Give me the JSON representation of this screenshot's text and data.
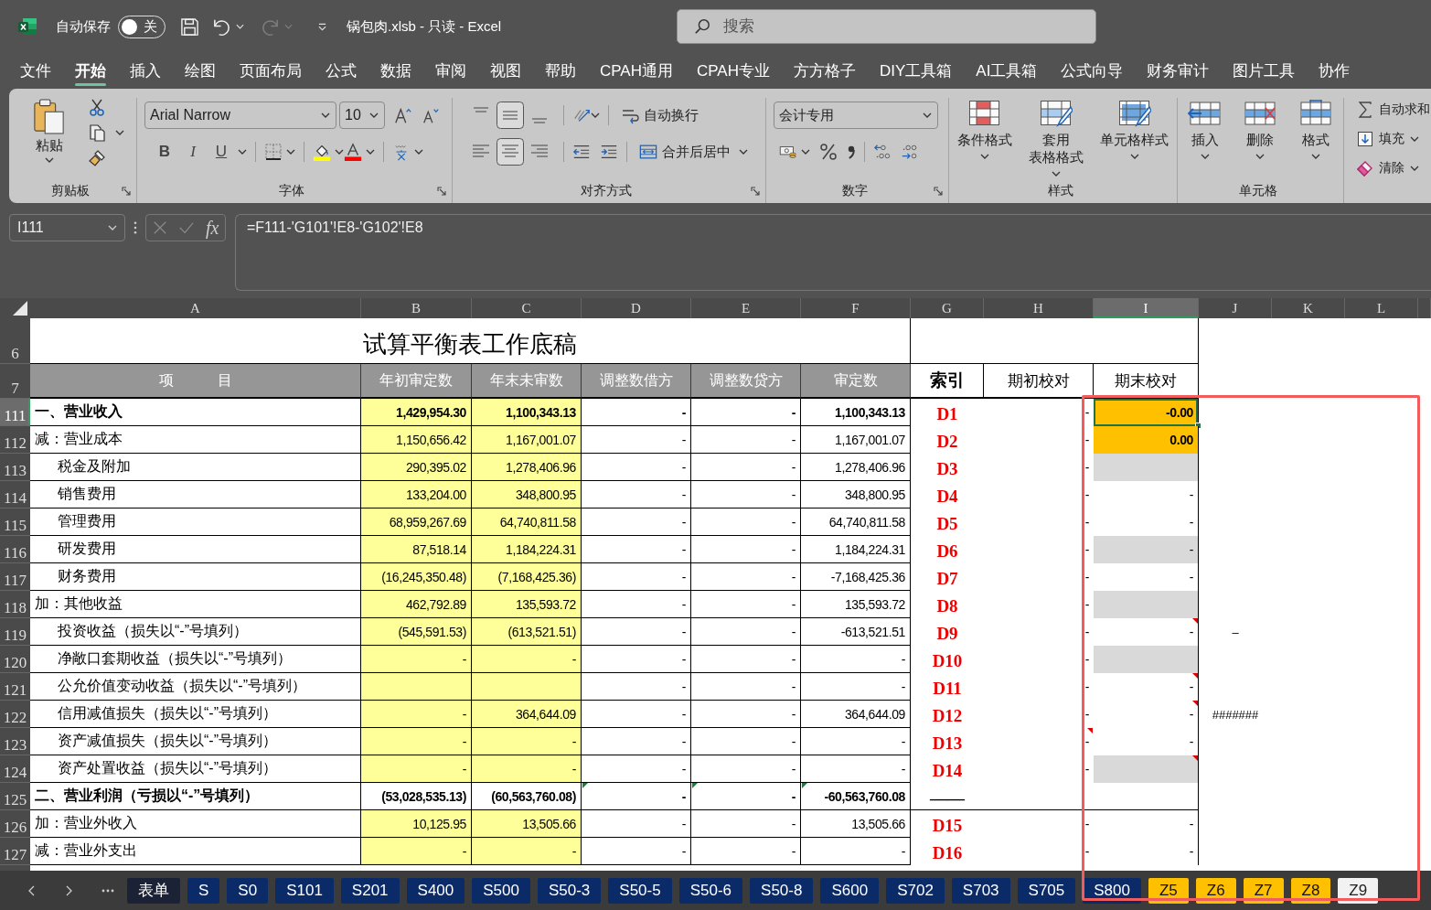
{
  "title_bar": {
    "autosave_label": "自动保存",
    "autosave_on": false,
    "autosave_state": "关",
    "redo_disabled": true,
    "document_title": "锅包肉.xlsb - 只读 - Excel",
    "search": {
      "placeholder": "搜索"
    }
  },
  "menu_tabs": [
    {
      "label": "文件",
      "selected": false
    },
    {
      "label": "开始",
      "selected": true
    },
    {
      "label": "插入",
      "selected": false
    },
    {
      "label": "绘图",
      "selected": false
    },
    {
      "label": "页面布局",
      "selected": false
    },
    {
      "label": "公式",
      "selected": false
    },
    {
      "label": "数据",
      "selected": false
    },
    {
      "label": "审阅",
      "selected": false
    },
    {
      "label": "视图",
      "selected": false
    },
    {
      "label": "帮助",
      "selected": false
    },
    {
      "label": "CPAH通用",
      "selected": false
    },
    {
      "label": "CPAH专业",
      "selected": false
    },
    {
      "label": "方方格子",
      "selected": false
    },
    {
      "label": "DIY工具箱",
      "selected": false
    },
    {
      "label": "AI工具箱",
      "selected": false
    },
    {
      "label": "公式向导",
      "selected": false
    },
    {
      "label": "财务审计",
      "selected": false
    },
    {
      "label": "图片工具",
      "selected": false
    },
    {
      "label": "协作",
      "selected": false
    }
  ],
  "ribbon": {
    "clipboard": {
      "paste_label": "粘贴",
      "group_label": "剪贴板"
    },
    "font": {
      "font_name": "Arial Narrow",
      "font_size": "10",
      "style_buttons": [
        "B",
        "I",
        "U"
      ],
      "group_label": "字体"
    },
    "alignment": {
      "vertical": [
        {
          "selected": false
        },
        {
          "selected": true
        },
        {
          "selected": false
        }
      ],
      "horizontal": [
        {
          "selected": false
        },
        {
          "selected": true
        },
        {
          "selected": false
        }
      ],
      "wrap_label": "自动换行",
      "merge_label": "合并后居中",
      "group_label": "对齐方式"
    },
    "number": {
      "format": "会计专用",
      "group_label": "数字"
    },
    "styles": {
      "buttons": [
        {
          "kind": "conditional",
          "lines": [
            "条件格式"
          ]
        },
        {
          "kind": "table",
          "lines": [
            "套用",
            "表格格式"
          ]
        },
        {
          "kind": "cell_style",
          "lines": [
            "单元格样式"
          ]
        }
      ],
      "group_label": "样式"
    },
    "cells": {
      "buttons": [
        {
          "kind": "insert",
          "label": "插入"
        },
        {
          "kind": "delete",
          "label": "删除"
        },
        {
          "kind": "format",
          "label": "格式"
        }
      ],
      "group_label": "单元格"
    },
    "editing": {
      "items": [
        {
          "kind": "sum",
          "label": "自动求和"
        },
        {
          "kind": "fill",
          "label": "填充"
        },
        {
          "kind": "clear",
          "label": "清除"
        }
      ]
    }
  },
  "formula_bar": {
    "name_box": "I111",
    "function_label": "fx",
    "formula": "=F111-'G101'!E8-'G102'!E8"
  },
  "sheet": {
    "columns": [
      {
        "letter": "A",
        "selected": false
      },
      {
        "letter": "B",
        "selected": false
      },
      {
        "letter": "C",
        "selected": false
      },
      {
        "letter": "D",
        "selected": false
      },
      {
        "letter": "E",
        "selected": false
      },
      {
        "letter": "F",
        "selected": false
      },
      {
        "letter": "G",
        "selected": false
      },
      {
        "letter": "H",
        "selected": false
      },
      {
        "letter": "I",
        "selected": true
      },
      {
        "letter": "J",
        "selected": false
      },
      {
        "letter": "K",
        "selected": false
      },
      {
        "letter": "L",
        "selected": false
      }
    ],
    "title_row": "6",
    "title": "试算平衡表工作底稿",
    "header_row": "7",
    "headers": [
      "项　　　目",
      "年初审定数",
      "年末未审数",
      "调整数借方",
      "调整数贷方",
      "审定数",
      "索引",
      "期初校对",
      "期末校对"
    ],
    "rows": [
      {
        "number": "111",
        "selected": true,
        "kind": "item",
        "bold": true,
        "indented": false,
        "item": "一、营业收入",
        "opening_audited": "1,429,954.30",
        "closing_unaudited": "1,100,343.13",
        "adjust_debit": "-",
        "adjust_credit": "-",
        "audited": "1,100,343.13",
        "index": "D1",
        "opening_check": {
          "text": "-",
          "comment": false
        },
        "closing_check": {
          "text": "-0.00",
          "color": "#ffc000",
          "bold": true,
          "comment": false
        }
      },
      {
        "number": "112",
        "selected": false,
        "kind": "item",
        "bold": false,
        "indented": false,
        "item": "减：营业成本",
        "opening_audited": "1,150,656.42",
        "closing_unaudited": "1,167,001.07",
        "adjust_debit": "-",
        "adjust_credit": "-",
        "audited": "1,167,001.07",
        "index": "D2",
        "opening_check": {
          "text": "-",
          "comment": false
        },
        "closing_check": {
          "text": "0.00",
          "color": "#ffc000",
          "bold": true,
          "comment": false
        }
      },
      {
        "number": "113",
        "selected": false,
        "kind": "item",
        "bold": false,
        "indented": true,
        "item": "税金及附加",
        "opening_audited": "290,395.02",
        "closing_unaudited": "1,278,406.96",
        "adjust_debit": "-",
        "adjust_credit": "-",
        "audited": "1,278,406.96",
        "index": "D3",
        "opening_check": {
          "text": "-",
          "comment": false
        },
        "closing_check": {
          "color": "#d9d9d9",
          "comment": false
        }
      },
      {
        "number": "114",
        "selected": false,
        "kind": "item",
        "bold": false,
        "indented": true,
        "item": "销售费用",
        "opening_audited": "133,204.00",
        "closing_unaudited": "348,800.95",
        "adjust_debit": "-",
        "adjust_credit": "-",
        "audited": "348,800.95",
        "index": "D4",
        "opening_check": {
          "text": "-",
          "comment": false
        },
        "closing_check": {
          "text": "-",
          "bold": false,
          "comment": false
        }
      },
      {
        "number": "115",
        "selected": false,
        "kind": "item",
        "bold": false,
        "indented": true,
        "item": "管理费用",
        "opening_audited": "68,959,267.69",
        "closing_unaudited": "64,740,811.58",
        "adjust_debit": "-",
        "adjust_credit": "-",
        "audited": "64,740,811.58",
        "index": "D5",
        "opening_check": {
          "text": "-",
          "comment": false
        },
        "closing_check": {
          "text": "-",
          "bold": false,
          "comment": false
        }
      },
      {
        "number": "116",
        "selected": false,
        "kind": "item",
        "bold": false,
        "indented": true,
        "item": "研发费用",
        "opening_audited": "87,518.14",
        "closing_unaudited": "1,184,224.31",
        "adjust_debit": "-",
        "adjust_credit": "-",
        "audited": "1,184,224.31",
        "index": "D6",
        "opening_check": {
          "text": "-",
          "comment": false
        },
        "closing_check": {
          "text": "-",
          "color": "#d9d9d9",
          "bold": false,
          "comment": false
        }
      },
      {
        "number": "117",
        "selected": false,
        "kind": "item",
        "bold": false,
        "indented": true,
        "item": "财务费用",
        "opening_audited": "(16,245,350.48)",
        "closing_unaudited": "(7,168,425.36)",
        "adjust_debit": "-",
        "adjust_credit": "-",
        "audited": "-7,168,425.36",
        "index": "D7",
        "opening_check": {
          "text": "-",
          "comment": false
        },
        "closing_check": {
          "text": "-",
          "bold": false,
          "comment": false
        }
      },
      {
        "number": "118",
        "selected": false,
        "kind": "item",
        "bold": false,
        "indented": false,
        "item": "加：其他收益",
        "opening_audited": "462,792.89",
        "closing_unaudited": "135,593.72",
        "adjust_debit": "-",
        "adjust_credit": "-",
        "audited": "135,593.72",
        "index": "D8",
        "opening_check": {
          "text": "-",
          "comment": false
        },
        "closing_check": {
          "color": "#d9d9d9",
          "comment": false
        }
      },
      {
        "number": "119",
        "selected": false,
        "kind": "item",
        "bold": false,
        "indented": true,
        "item": "投资收益（损失以“-”号填列）",
        "opening_audited": "(545,591.53)",
        "closing_unaudited": "(613,521.51)",
        "adjust_debit": "-",
        "adjust_credit": "-",
        "audited": "-613,521.51",
        "index": "D9",
        "opening_check": {
          "text": "-",
          "comment": false
        },
        "closing_check": {
          "text": "-",
          "bold": false,
          "comment": true
        },
        "column_j": "–"
      },
      {
        "number": "120",
        "selected": false,
        "kind": "item",
        "bold": false,
        "indented": true,
        "item": "净敞口套期收益（损失以“-”号填列）",
        "opening_audited": "-",
        "closing_unaudited": "-",
        "adjust_debit": "-",
        "adjust_credit": "-",
        "audited": "-",
        "index": "D10",
        "opening_check": {
          "text": "-",
          "comment": false
        },
        "closing_check": {
          "color": "#d9d9d9",
          "comment": false
        }
      },
      {
        "number": "121",
        "selected": false,
        "kind": "item",
        "bold": false,
        "indented": true,
        "item": "公允价值变动收益（损失以“-”号填列）",
        "adjust_debit": "-",
        "adjust_credit": "-",
        "audited": "-",
        "index": "D11",
        "opening_check": {
          "text": "-",
          "comment": false
        },
        "closing_check": {
          "text": "-",
          "bold": false,
          "comment": true
        }
      },
      {
        "number": "122",
        "selected": false,
        "kind": "item",
        "bold": false,
        "indented": true,
        "item": "信用减值损失（损失以“-”号填列）",
        "opening_audited": "-",
        "closing_unaudited": "364,644.09",
        "adjust_debit": "-",
        "adjust_credit": "-",
        "audited": "364,644.09",
        "index": "D12",
        "opening_check": {
          "text": "-",
          "comment": false
        },
        "closing_check": {
          "text": "-",
          "bold": false,
          "comment": true
        },
        "column_j": "#######"
      },
      {
        "number": "123",
        "selected": false,
        "kind": "item",
        "bold": false,
        "indented": true,
        "item": "资产减值损失（损失以“-”号填列）",
        "opening_audited": "-",
        "closing_unaudited": "-",
        "adjust_debit": "-",
        "adjust_credit": "-",
        "audited": "-",
        "index": "D13",
        "opening_check": {
          "text": "-",
          "comment": true
        },
        "closing_check": {
          "text": "-",
          "bold": false,
          "comment": false
        }
      },
      {
        "number": "124",
        "selected": false,
        "kind": "item",
        "bold": false,
        "indented": true,
        "item": "资产处置收益（损失以“-”号填列）",
        "opening_audited": "-",
        "closing_unaudited": "-",
        "adjust_debit": "-",
        "adjust_credit": "-",
        "audited": "-",
        "index": "D14",
        "opening_check": {
          "text": "-",
          "comment": false
        },
        "closing_check": {
          "color": "#d9d9d9",
          "comment": true
        }
      },
      {
        "number": "125",
        "selected": false,
        "kind": "subtotal",
        "bold": true,
        "indented": false,
        "item": "二、营业利润（亏损以“-”号填列）",
        "opening_audited": "(53,028,535.13)",
        "closing_unaudited": "(60,563,760.08)",
        "adjust_debit": "-",
        "adjust_credit": "-",
        "audited": "-60,563,760.08",
        "index": "——",
        "opening_check": {
          "comment": false
        },
        "closing_check": {
          "comment": false
        }
      },
      {
        "number": "126",
        "selected": false,
        "kind": "item",
        "bold": false,
        "indented": false,
        "item": "加：营业外收入",
        "opening_audited": "10,125.95",
        "closing_unaudited": "13,505.66",
        "adjust_debit": "-",
        "adjust_credit": "-",
        "audited": "13,505.66",
        "index": "D15",
        "opening_check": {
          "text": "-",
          "comment": false
        },
        "closing_check": {
          "text": "-",
          "bold": false,
          "comment": false
        }
      },
      {
        "number": "127",
        "selected": false,
        "kind": "item",
        "bold": false,
        "indented": false,
        "item": "减：营业外支出",
        "opening_audited": "-",
        "closing_unaudited": "-",
        "adjust_debit": "-",
        "adjust_credit": "-",
        "audited": "-",
        "index": "D16",
        "opening_check": {
          "text": "-",
          "comment": false
        },
        "closing_check": {
          "text": "-",
          "bold": false,
          "comment": false
        }
      }
    ]
  },
  "sheet_tabs": [
    {
      "label": "表单",
      "color": "#1c2236",
      "selected": false
    },
    {
      "label": "S",
      "color": "#0b2a68",
      "selected": false
    },
    {
      "label": "S0",
      "color": "#0b2a68",
      "selected": false
    },
    {
      "label": "S101",
      "color": "#0b2a68",
      "selected": false
    },
    {
      "label": "S201",
      "color": "#0b2a68",
      "selected": false
    },
    {
      "label": "S400",
      "color": "#0b2a68",
      "selected": false
    },
    {
      "label": "S500",
      "color": "#0b2a68",
      "selected": false
    },
    {
      "label": "S50-3",
      "color": "#0b2a68",
      "selected": false
    },
    {
      "label": "S50-5",
      "color": "#0b2a68",
      "selected": false
    },
    {
      "label": "S50-6",
      "color": "#0b2a68",
      "selected": false
    },
    {
      "label": "S50-8",
      "color": "#0b2a68",
      "selected": false
    },
    {
      "label": "S600",
      "color": "#0b2a68",
      "selected": false
    },
    {
      "label": "S702",
      "color": "#0b2a68",
      "selected": false
    },
    {
      "label": "S703",
      "color": "#0b2a68",
      "selected": false
    },
    {
      "label": "S705",
      "color": "#0b2a68",
      "selected": false
    },
    {
      "label": "S800",
      "color": "#0b2a68",
      "selected": false
    },
    {
      "label": "Z5",
      "color": "#ffc000",
      "selected": false
    },
    {
      "label": "Z6",
      "color": "#ffc000",
      "selected": false
    },
    {
      "label": "Z7",
      "color": "#ffc000",
      "selected": false
    },
    {
      "label": "Z8",
      "color": "#ffc000",
      "selected": false
    },
    {
      "label": "Z9",
      "selected": true
    }
  ]
}
